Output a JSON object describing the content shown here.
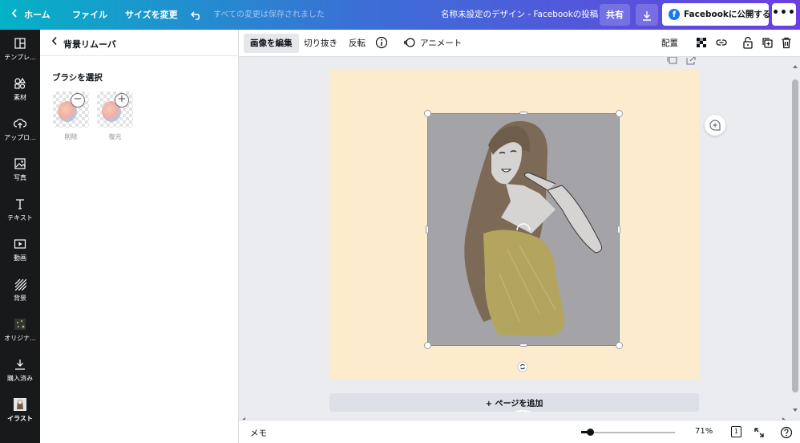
{
  "topbar": {
    "home": "ホーム",
    "file": "ファイル",
    "resize": "サイズを変更",
    "save_status": "すべての変更は保存されました",
    "doc_title": "名称未設定のデザイン - Facebookの投稿",
    "share": "共有",
    "publish": "Facebookに公開する",
    "more": "•••"
  },
  "leftnav": {
    "items": [
      {
        "label": "テンプレ...",
        "icon": "template-icon"
      },
      {
        "label": "素材",
        "icon": "elements-icon"
      },
      {
        "label": "アップロ...",
        "icon": "upload-icon"
      },
      {
        "label": "写真",
        "icon": "photo-icon"
      },
      {
        "label": "テキスト",
        "icon": "text-icon"
      },
      {
        "label": "動画",
        "icon": "video-icon"
      },
      {
        "label": "背景",
        "icon": "background-icon"
      },
      {
        "label": "オリジナ...",
        "icon": "original-icon"
      },
      {
        "label": "購入済み",
        "icon": "purchased-icon"
      },
      {
        "label": "イラスト",
        "icon": "illustration-icon"
      }
    ]
  },
  "panel": {
    "title": "背景リムーバ",
    "brush_heading": "ブラシを選択",
    "brushes": [
      {
        "label": "削除",
        "mark": "−"
      },
      {
        "label": "復元",
        "mark": "+"
      }
    ]
  },
  "toolbar": {
    "edit_image": "画像を編集",
    "crop": "切り抜き",
    "flip": "反転",
    "animate": "アニメート",
    "position": "配置"
  },
  "canvas": {
    "add_page": "+ ページを追加"
  },
  "bottombar": {
    "memo": "メモ",
    "zoom": "71%",
    "page_number": "1",
    "zoom_fraction": 0.1
  },
  "colors": {
    "accent": "#00c4cc",
    "page_bg": "#fdebce",
    "nav_bg": "#18191b"
  }
}
